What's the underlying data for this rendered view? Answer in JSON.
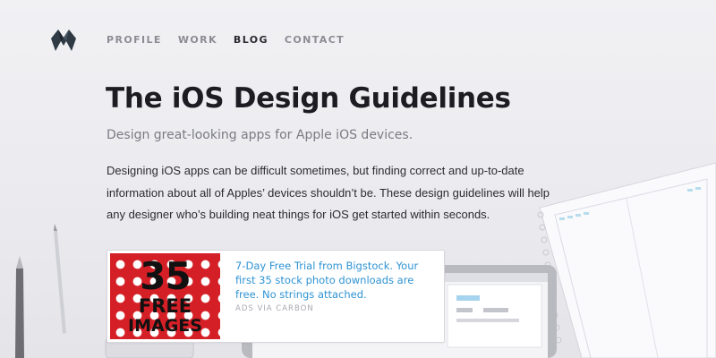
{
  "brand": {
    "logo_icon": "m-monogram-icon"
  },
  "nav": {
    "items": [
      {
        "label": "PROFILE",
        "active": false
      },
      {
        "label": "WORK",
        "active": false
      },
      {
        "label": "BLOG",
        "active": true
      },
      {
        "label": "CONTACT",
        "active": false
      }
    ]
  },
  "hero": {
    "title": "The iOS Design Guidelines",
    "subtitle": "Design great-looking apps for Apple iOS devices.",
    "body": "Designing iOS apps can be difficult sometimes, but finding correct and up-to-date information about all of Apples’ devices shouldn’t be. These design guidelines will help any designer who’s building neat things for iOS get started within seconds."
  },
  "ad": {
    "image": {
      "number": "35",
      "line1": "FREE",
      "line2": "IMAGES"
    },
    "text": "7-Day Free Trial from Bigstock. Your first 35 stock photo downloads are free. No strings attached.",
    "via": "ADS VIA CARBON"
  },
  "colors": {
    "background": "#eeeef1",
    "link": "#2f93d3",
    "ad_red": "#d51f26",
    "nav_active": "#2a2a30",
    "nav_inactive": "#8c8c95"
  }
}
